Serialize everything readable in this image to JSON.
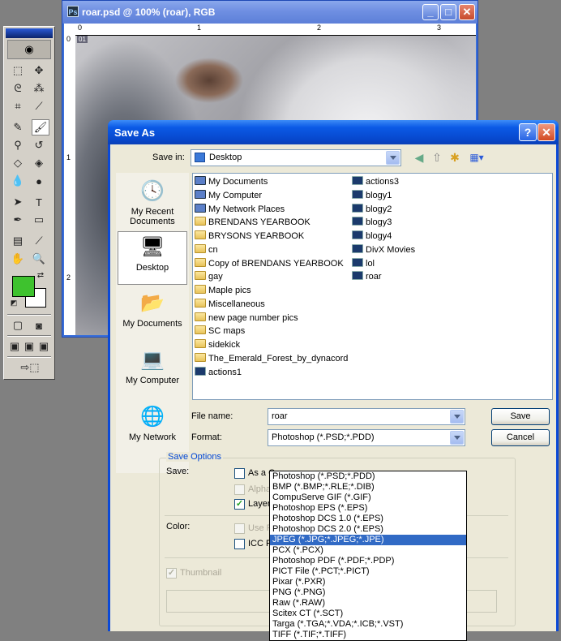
{
  "document_window": {
    "title": "roar.psd @ 100% (roar), RGB",
    "ruler_top": [
      "0",
      "1",
      "2",
      "3"
    ],
    "ruler_left": [
      "0",
      "1",
      "2"
    ],
    "corner_label": "01"
  },
  "toolbox": {
    "colors": {
      "foreground": "#3ec22e",
      "background": "#ffffff"
    }
  },
  "dialog": {
    "title": "Save As",
    "help_label": "?",
    "close_label": "✕",
    "save_in_label": "Save in:",
    "save_in_value": "Desktop",
    "places": [
      "My Recent Documents",
      "Desktop",
      "My Documents",
      "My Computer",
      "My Network"
    ],
    "files_col1": [
      {
        "name": "My Documents",
        "type": "sys"
      },
      {
        "name": "My Computer",
        "type": "sys"
      },
      {
        "name": "My Network Places",
        "type": "sys"
      },
      {
        "name": "BRENDANS YEARBOOK",
        "type": "folder"
      },
      {
        "name": "BRYSONS YEARBOOK",
        "type": "folder"
      },
      {
        "name": "cn",
        "type": "folder"
      },
      {
        "name": "Copy of BRENDANS YEARBOOK",
        "type": "folder"
      },
      {
        "name": "gay",
        "type": "folder"
      },
      {
        "name": "Maple pics",
        "type": "folder"
      },
      {
        "name": "Miscellaneous",
        "type": "folder"
      },
      {
        "name": "new page number pics",
        "type": "folder"
      },
      {
        "name": "SC maps",
        "type": "folder"
      },
      {
        "name": "sidekick",
        "type": "folder"
      },
      {
        "name": "The_Emerald_Forest_by_dynacord",
        "type": "folder"
      },
      {
        "name": "actions1",
        "type": "psd"
      }
    ],
    "files_col2": [
      {
        "name": "actions3",
        "type": "psd"
      },
      {
        "name": "blogy1",
        "type": "psd"
      },
      {
        "name": "blogy2",
        "type": "psd"
      },
      {
        "name": "blogy3",
        "type": "psd"
      },
      {
        "name": "blogy4",
        "type": "psd"
      },
      {
        "name": "DivX Movies",
        "type": "psd"
      },
      {
        "name": "lol",
        "type": "psd"
      },
      {
        "name": "roar",
        "type": "psd"
      }
    ],
    "file_name_label": "File name:",
    "file_name_value": "roar",
    "format_label": "Format:",
    "format_value": "Photoshop (*.PSD;*.PDD)",
    "save_button": "Save",
    "cancel_button": "Cancel",
    "save_options": {
      "title": "Save Options",
      "save_label": "Save:",
      "as_copy": "As a C",
      "alpha": "Alpha",
      "layers": "Layer",
      "color_label": "Color:",
      "use_proof": "Use P",
      "icc": "ICC P",
      "thumbnail": "Thumbnail"
    },
    "format_options": [
      "Photoshop (*.PSD;*.PDD)",
      "BMP (*.BMP;*.RLE;*.DIB)",
      "CompuServe GIF (*.GIF)",
      "Photoshop EPS (*.EPS)",
      "Photoshop DCS 1.0 (*.EPS)",
      "Photoshop DCS 2.0 (*.EPS)",
      "JPEG (*.JPG;*.JPEG;*.JPE)",
      "PCX (*.PCX)",
      "Photoshop PDF (*.PDF;*.PDP)",
      "PICT File (*.PCT;*.PICT)",
      "Pixar (*.PXR)",
      "PNG (*.PNG)",
      "Raw (*.RAW)",
      "Scitex CT (*.SCT)",
      "Targa (*.TGA;*.VDA;*.ICB;*.VST)",
      "TIFF (*.TIF;*.TIFF)"
    ],
    "highlighted_format_index": 6
  }
}
